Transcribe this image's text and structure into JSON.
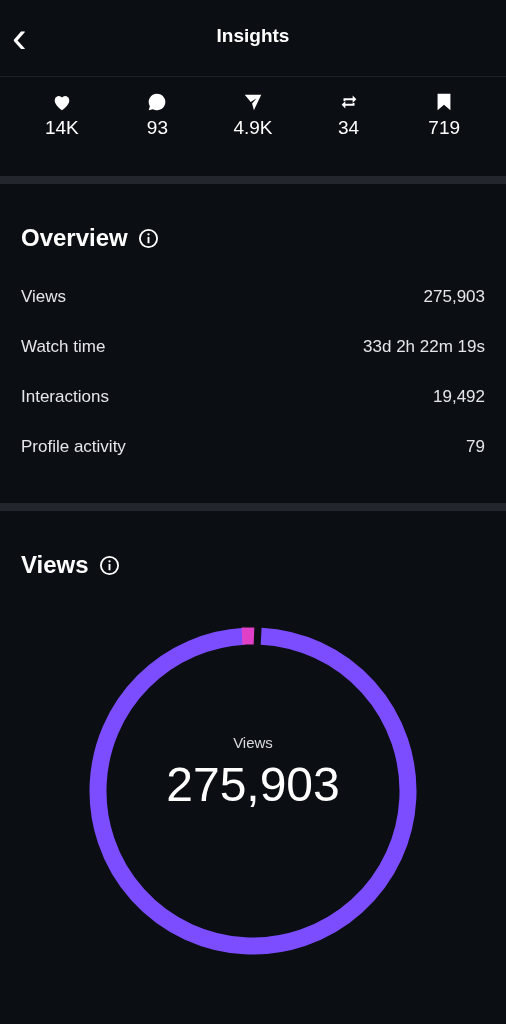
{
  "header": {
    "back": "‹",
    "title": "Insights"
  },
  "stats": [
    {
      "kind": "likes",
      "value": "14K"
    },
    {
      "kind": "comments",
      "value": "93"
    },
    {
      "kind": "shares",
      "value": "4.9K"
    },
    {
      "kind": "reposts",
      "value": "34"
    },
    {
      "kind": "saves",
      "value": "719"
    }
  ],
  "overview": {
    "title": "Overview",
    "rows": [
      {
        "label": "Views",
        "value": "275,903"
      },
      {
        "label": "Watch time",
        "value": "33d 2h 22m 19s"
      },
      {
        "label": "Interactions",
        "value": "19,492"
      },
      {
        "label": "Profile activity",
        "value": "79"
      }
    ]
  },
  "views": {
    "title": "Views",
    "center_label": "Views",
    "center_value": "275,903"
  }
}
